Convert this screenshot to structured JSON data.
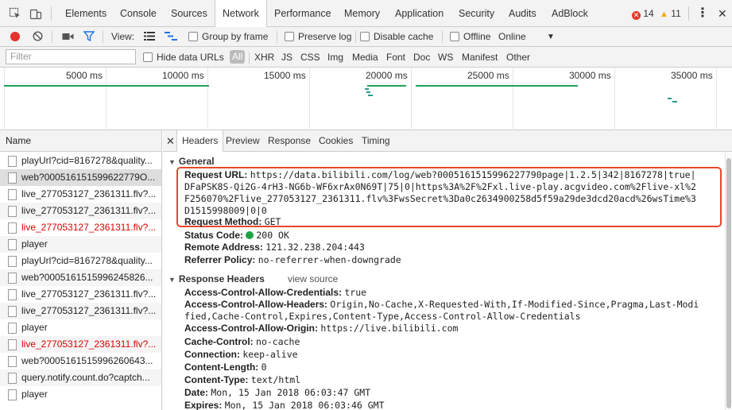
{
  "tabs": [
    "Elements",
    "Console",
    "Sources",
    "Network",
    "Performance",
    "Memory",
    "Application",
    "Security",
    "Audits",
    "AdBlock"
  ],
  "active_tab": "Network",
  "errors_count": "14",
  "warnings_count": "11",
  "toolbar": {
    "view_label": "View:",
    "group_by_frame": "Group by frame",
    "preserve_log": "Preserve log",
    "disable_cache": "Disable cache",
    "offline": "Offline",
    "throttle": "Online"
  },
  "filter": {
    "placeholder": "Filter",
    "hide_data_urls": "Hide data URLs",
    "all": "All",
    "types": [
      "XHR",
      "JS",
      "CSS",
      "Img",
      "Media",
      "Font",
      "Doc",
      "WS",
      "Manifest",
      "Other"
    ]
  },
  "overview": {
    "ticks": [
      "5000 ms",
      "10000 ms",
      "15000 ms",
      "20000 ms",
      "25000 ms",
      "30000 ms",
      "35000 ms"
    ]
  },
  "requests": {
    "header": "Name",
    "rows": [
      {
        "name": "playUrl?cid=8167278&quality...",
        "error": false
      },
      {
        "name": "web?000516151599622779O...",
        "error": false
      },
      {
        "name": "live_277053127_2361311.flv?...",
        "error": false
      },
      {
        "name": "live_277053127_2361311.flv?...",
        "error": false
      },
      {
        "name": "live_277053127_2361311.flv?...",
        "error": true
      },
      {
        "name": "player",
        "error": false
      },
      {
        "name": "playUrl?cid=8167278&quality...",
        "error": false
      },
      {
        "name": "web?00051615159962458­26...",
        "error": false
      },
      {
        "name": "live_277053127_2361311.flv?...",
        "error": false
      },
      {
        "name": "live_277053127_2361311.flv?...",
        "error": false
      },
      {
        "name": "player",
        "error": false
      },
      {
        "name": "live_277053127_2361311.flv?...",
        "error": true
      },
      {
        "name": "web?000516151599626064­3...",
        "error": false
      },
      {
        "name": "query.notify.count.do?captch...",
        "error": false
      },
      {
        "name": "player",
        "error": false
      }
    ]
  },
  "detail_tabs": [
    "Headers",
    "Preview",
    "Response",
    "Cookies",
    "Timing"
  ],
  "general": {
    "title": "General",
    "request_url_key": "Request URL:",
    "request_url_lines": [
      "https://data.bilibili.com/log/web?0005161515996227790page|1.2.5|342|8167278|true|",
      "DFaPSK8S-Qi2G-4rH3-NG6b-WF6xrAx0N69T|75|0|https%3A%2F%2Fxl.live-play.acgvideo.com%2Flive-xl%2",
      "F256070%2Flive_277053127_2361311.flv%3FwsSecret%3Da0c2634900258d5f59a29de3dcd20acd%26wsTime%3",
      "D1515998009|0|0"
    ],
    "request_method_key": "Request Method:",
    "request_method": "GET",
    "status_code_key": "Status Code:",
    "status_code": "200 OK",
    "remote_address_key": "Remote Address:",
    "remote_address": "121.32.238.204:443",
    "referrer_policy_key": "Referrer Policy:",
    "referrer_policy": "no-referrer-when-downgrade"
  },
  "response_headers": {
    "title": "Response Headers",
    "view_source": "view source",
    "acac_key": "Access-Control-Allow-Credentials:",
    "acac": "true",
    "acah_key": "Access-Control-Allow-Headers:",
    "acah_lines": [
      "Origin,No-Cache,X-Requested-With,If-Modified-Since,Pragma,Last-Modi",
      "fied,Cache-Control,Expires,Content-Type,Access-Control-Allow-Credentials"
    ],
    "acao_key": "Access-Control-Allow-Origin:",
    "acao": "https://live.bilibili.com",
    "cache_control_key": "Cache-Control:",
    "cache_control": "no-cache",
    "connection_key": "Connection:",
    "connection": "keep-alive",
    "content_length_key": "Content-Length:",
    "content_length": "0",
    "content_type_key": "Content-Type:",
    "content_type": "text/html",
    "date_key": "Date:",
    "date": "Mon, 15 Jan 2018 06:03:47 GMT",
    "expires_key": "Expires:",
    "expires": "Mon, 15 Jan 2018 06:03:46 GMT"
  }
}
